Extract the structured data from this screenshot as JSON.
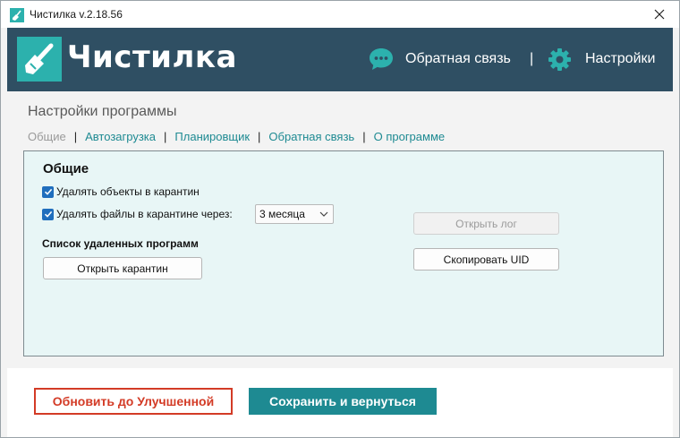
{
  "window": {
    "title": "Чистилка v.2.18.56"
  },
  "header": {
    "logo_text": "Чистилка",
    "feedback_label": "Обратная связь",
    "separator": "|",
    "settings_label": "Настройки"
  },
  "page": {
    "title": "Настройки программы"
  },
  "tabs": [
    {
      "label": "Общие",
      "active": true
    },
    {
      "label": "Автозагрузка",
      "active": false
    },
    {
      "label": "Планировщик",
      "active": false
    },
    {
      "label": "Обратная связь",
      "active": false
    },
    {
      "label": "О программе",
      "active": false
    }
  ],
  "tab_separator": "|",
  "general": {
    "heading": "Общие",
    "delete_to_quarantine": {
      "label": "Удалять объекты в карантин",
      "checked": true
    },
    "delete_quarantine_after": {
      "label": "Удалять файлы в карантине через:",
      "checked": true
    },
    "period_select": {
      "value": "3 месяца"
    },
    "removed_programs_heading": "Список удаленных программ",
    "open_quarantine_label": "Открыть карантин",
    "open_log_label": "Открыть лог",
    "copy_uid_label": "Скопировать UID"
  },
  "footer": {
    "upgrade_label": "Обновить до Улучшенной",
    "save_label": "Сохранить и вернуться"
  },
  "colors": {
    "header_bg": "#2f4f63",
    "accent_teal": "#1e8a92",
    "logo_teal": "#2cb1ad",
    "upgrade_red": "#d33b26",
    "panel_bg": "#e8f6f6",
    "checkbox_blue": "#1f6ebd"
  }
}
